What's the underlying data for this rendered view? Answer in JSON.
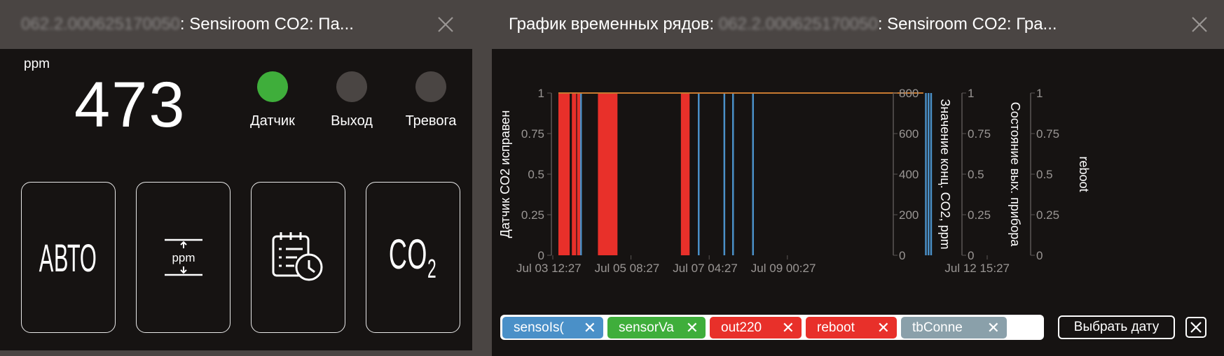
{
  "left_panel": {
    "title_prefix": "062.2.000625170050",
    "title": ": Sensiroom CO2: Па...",
    "unit": "ppm",
    "value": "473",
    "indicators": [
      {
        "label": "Датчик",
        "color": "#3fae3b"
      },
      {
        "label": "Выход",
        "color": "#4a4543"
      },
      {
        "label": "Тревога",
        "color": "#4a4543"
      }
    ],
    "tiles": [
      {
        "label": "АВТО",
        "icon": "auto-mode-icon"
      },
      {
        "label": "ppm",
        "icon": "ppm-setpoint-icon"
      },
      {
        "label": "",
        "icon": "schedule-clock-icon"
      },
      {
        "label": "CO",
        "sub": "2",
        "icon": "co2-icon"
      }
    ]
  },
  "right_panel": {
    "title_main": "График временных рядов: ",
    "title_prefix": "062.2.000625170050",
    "title": ": Sensiroom CO2: Гра...",
    "legend": [
      {
        "label": "sensoIs(",
        "color": "#4a90c8"
      },
      {
        "label": "sensorVa",
        "color": "#3fae3b"
      },
      {
        "label": "out220",
        "color": "#e8302a"
      },
      {
        "label": "reboot",
        "color": "#e8302a"
      },
      {
        "label": "tbConne",
        "color": "#8aa0aa"
      }
    ],
    "date_button": "Выбрать дату"
  },
  "chart_data": {
    "type": "area",
    "x_ticks": [
      "Jul 03 12:27",
      "Jul 05 08:27",
      "Jul 07 04:27",
      "Jul 09 00:27",
      "Jul 12 15:27"
    ],
    "axes": [
      {
        "label": "Датчик CO2 исправен",
        "ticks": [
          "0",
          "0.25",
          "0.5",
          "0.75",
          "1"
        ],
        "range": [
          0,
          1
        ]
      },
      {
        "label": "Значение конц. CO2, ppm",
        "ticks": [
          "0",
          "200",
          "400",
          "600",
          "800"
        ],
        "range": [
          0,
          800
        ]
      },
      {
        "label": "Состояние вых. прибора",
        "ticks": [
          "0",
          "0.25",
          "0.5",
          "0.75",
          "1"
        ],
        "range": [
          0,
          1
        ]
      },
      {
        "label": "reboot",
        "ticks": [
          "0",
          "0.25",
          "0.5",
          "0.75",
          "1"
        ],
        "range": [
          0,
          1
        ]
      }
    ],
    "series": [
      {
        "name": "sensoIs(",
        "color": "#4a90c8",
        "type": "lines",
        "x_fraction": [
          0.052,
          0.323,
          0.382,
          0.402,
          0.448,
          0.846,
          0.852,
          0.858
        ]
      },
      {
        "name": "sensorVa",
        "color": "#8a9a3a",
        "type": "flat",
        "y": 1
      },
      {
        "name": "out220",
        "color": "#e8302a",
        "type": "spans",
        "spans": [
          [
            0.0,
            0.026
          ],
          [
            0.031,
            0.041
          ],
          [
            0.091,
            0.136
          ],
          [
            0.282,
            0.302
          ]
        ]
      },
      {
        "name": "reboot",
        "color": "#e8302a",
        "type": "lines",
        "x_fraction": [
          0.045,
          0.048
        ]
      },
      {
        "name": "tbConne",
        "color": "#c87a30",
        "type": "flat",
        "y": 1
      }
    ]
  }
}
